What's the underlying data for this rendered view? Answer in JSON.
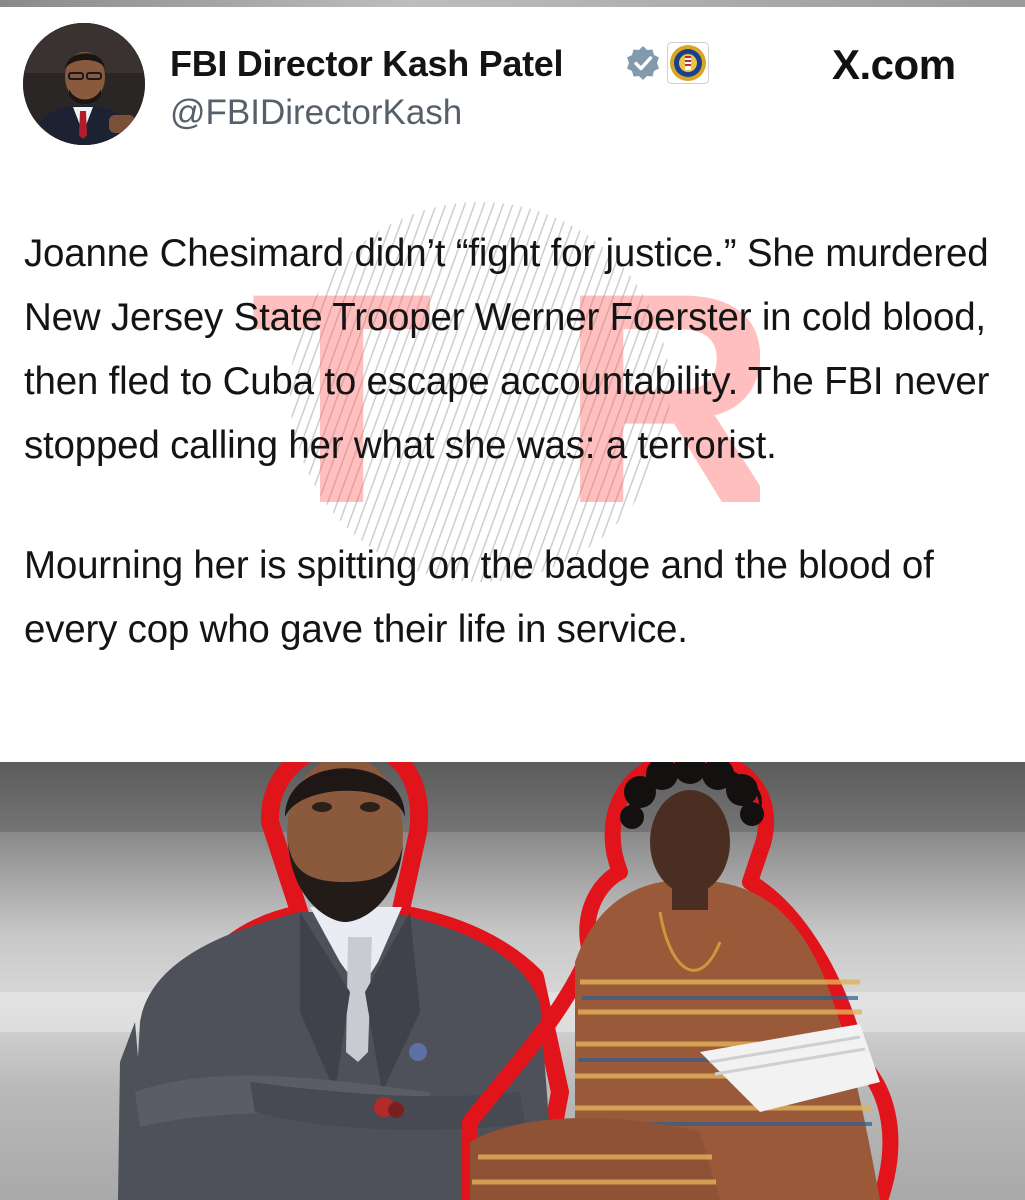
{
  "post": {
    "display_name": "FBI Director Kash Patel",
    "handle": "@FBIDirectorKash",
    "site": "X.com",
    "paragraphs": [
      "Joanne Chesimard didn’t “fight for justice.” She murdered New Jersey State Trooper Werner Foerster in cold blood, then fled to Cuba to escape accountability. The FBI never stopped calling her what she was: a terrorist.",
      "Mourning her is spitting on the badge and the blood of every cop who gave their life in service."
    ]
  },
  "icons": {
    "verified": "verified-badge-icon",
    "seal": "fbi-seal-icon",
    "watermark": "tsr-watermark-logo"
  },
  "colors": {
    "text": "#141414",
    "handle": "#57606a",
    "verified_badge": "#829aab",
    "watermark_red": "#ff5a5a",
    "cutout_outline": "#e0141a"
  },
  "watermark_letters": "TSR"
}
